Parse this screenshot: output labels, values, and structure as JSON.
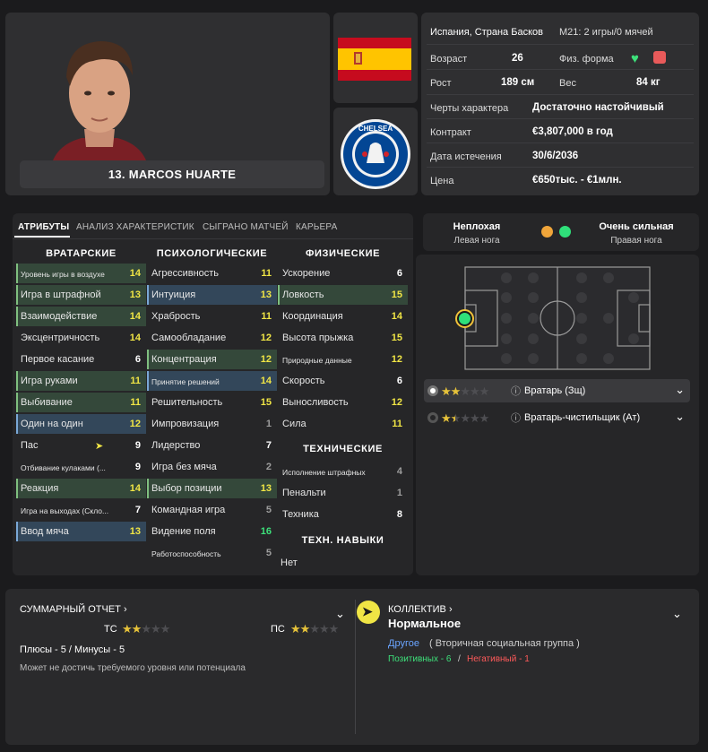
{
  "player": {
    "name": "13. MARCOS HUARTE"
  },
  "info": {
    "nation": "Испания, Страна Басков",
    "u21": "М21: 2 игры/0 мячей",
    "age_label": "Возраст",
    "age": "26",
    "fitness_label": "Физ. форма",
    "height_label": "Рост",
    "height": "189 см",
    "weight_label": "Вес",
    "weight": "84 кг",
    "personality_label": "Черты характера",
    "personality": "Достаточно настойчивый",
    "contract_label": "Контракт",
    "contract": "€3,807,000 в год",
    "expiry_label": "Дата истечения",
    "expiry": "30/6/2036",
    "price_label": "Цена",
    "price": "€650тыс. - €1млн."
  },
  "tabs": [
    "АТРИБУТЫ",
    "АНАЛИЗ ХАРАКТЕРИСТИК",
    "СЫГРАНО МАТЧЕЙ",
    "КАРЬЕРА"
  ],
  "columns": {
    "gk": "ВРАТАРСКИЕ",
    "mental": "ПСИХОЛОГИЧЕСКИЕ",
    "physical": "ФИЗИЧЕСКИЕ",
    "technical": "ТЕХНИЧЕСКИЕ",
    "tech_skills": "ТЕХН. НАВЫКИ"
  },
  "gk_attrs": [
    {
      "name": "Уровень игры в воздухе",
      "value": "14"
    },
    {
      "name": "Игра в штрафной",
      "value": "13"
    },
    {
      "name": "Взаимодействие",
      "value": "14"
    },
    {
      "name": "Эксцентричность",
      "value": "14"
    },
    {
      "name": "Первое касание",
      "value": "6"
    },
    {
      "name": "Игра руками",
      "value": "11"
    },
    {
      "name": "Выбивание",
      "value": "11"
    },
    {
      "name": "Один на один",
      "value": "12"
    },
    {
      "name": "Пас",
      "value": "9"
    },
    {
      "name": "Отбивание кулаками (...",
      "value": "9"
    },
    {
      "name": "Реакция",
      "value": "14"
    },
    {
      "name": "Игра на выходах (Скло...",
      "value": "7"
    },
    {
      "name": "Ввод мяча",
      "value": "13"
    }
  ],
  "mental_attrs": [
    {
      "name": "Агрессивность",
      "value": "11"
    },
    {
      "name": "Интуиция",
      "value": "13"
    },
    {
      "name": "Храбрость",
      "value": "11"
    },
    {
      "name": "Самообладание",
      "value": "12"
    },
    {
      "name": "Концентрация",
      "value": "12"
    },
    {
      "name": "Принятие решений",
      "value": "14"
    },
    {
      "name": "Решительность",
      "value": "15"
    },
    {
      "name": "Импровизация",
      "value": "1"
    },
    {
      "name": "Лидерство",
      "value": "7"
    },
    {
      "name": "Игра без мяча",
      "value": "2"
    },
    {
      "name": "Выбор позиции",
      "value": "13"
    },
    {
      "name": "Командная игра",
      "value": "5"
    },
    {
      "name": "Видение поля",
      "value": "16"
    },
    {
      "name": "Работоспособность",
      "value": "5"
    }
  ],
  "physical_attrs": [
    {
      "name": "Ускорение",
      "value": "6"
    },
    {
      "name": "Ловкость",
      "value": "15"
    },
    {
      "name": "Координация",
      "value": "14"
    },
    {
      "name": "Высота прыжка",
      "value": "15"
    },
    {
      "name": "Природные данные",
      "value": "12"
    },
    {
      "name": "Скорость",
      "value": "6"
    },
    {
      "name": "Выносливость",
      "value": "12"
    },
    {
      "name": "Сила",
      "value": "11"
    }
  ],
  "technical_attrs": [
    {
      "name": "Исполнение штрафных",
      "value": "4"
    },
    {
      "name": "Пенальти",
      "value": "1"
    },
    {
      "name": "Техника",
      "value": "8"
    }
  ],
  "tech_skills_value": "Нет",
  "feet": {
    "left_rating": "Неплохая",
    "left_label": "Левая нога",
    "right_rating": "Очень сильная",
    "right_label": "Правая нога",
    "left_color": "#f0a53a",
    "right_color": "#2fe07a"
  },
  "roles": [
    {
      "name": "Вратарь (Зщ)",
      "stars": 2
    },
    {
      "name": "Вратарь-чистильщик (Ат)",
      "stars": 1.5
    }
  ],
  "summary": {
    "title": "СУММАРНЫЙ ОТЧЕТ",
    "ca_label": "ТС",
    "ca_stars": 2,
    "pa_label": "ПС",
    "pa_stars": 2,
    "pros_cons": "Плюсы - 5 / Минусы - 5",
    "note": "Может не достичь требуемого уровня или потенциала"
  },
  "collective": {
    "title": "КОЛЛЕКТИВ",
    "status": "Нормальное",
    "group": "Другое",
    "group_desc": "( Вторичная социальная группа )",
    "positive": "Позитивных - 6",
    "slash": "/",
    "negative": "Негативный - 1"
  },
  "colors": {
    "accent_green": "#3de07a",
    "accent_yellow": "#f0e545",
    "highlight_green": "#34483a",
    "highlight_blue": "#33475a",
    "negative_red": "#ff5a5a"
  }
}
